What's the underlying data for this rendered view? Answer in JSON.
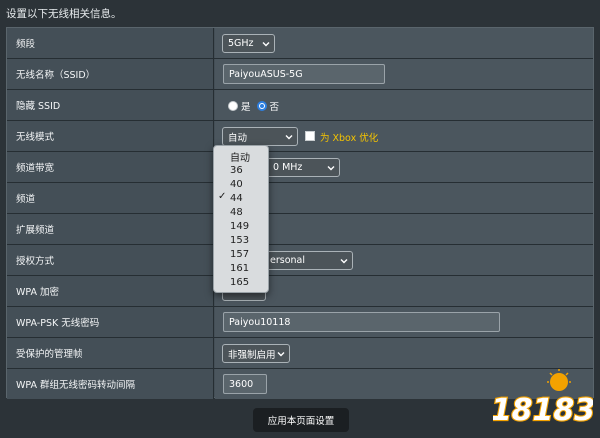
{
  "intro": "设置以下无线相关信息。",
  "rows": [
    {
      "label": "频段",
      "value": "5GHz"
    },
    {
      "label": "无线名称（SSID）",
      "value": "PaiyouASUS-5G"
    },
    {
      "label": "隐藏 SSID",
      "options": [
        "是",
        "否"
      ],
      "selected": "否"
    },
    {
      "label": "无线模式",
      "value": "自动",
      "xbox_option": "为 Xbox 优化"
    },
    {
      "label": "频道带宽",
      "value_visible": "0 MHz"
    },
    {
      "label": "频道"
    },
    {
      "label": "扩展频道"
    },
    {
      "label": "授权方式",
      "value_visible": "ersonal"
    },
    {
      "label": "WPA 加密"
    },
    {
      "label": "WPA-PSK 无线密码",
      "value": "Paiyou10118"
    },
    {
      "label": "受保护的管理帧",
      "value": "非强制启用"
    },
    {
      "label": "WPA 群组无线密码转动间隔",
      "value": "3600"
    }
  ],
  "channel_dropdown": {
    "options": [
      "自动",
      "36",
      "40",
      "44",
      "48",
      "149",
      "153",
      "157",
      "161",
      "165"
    ],
    "selected": "44"
  },
  "apply_button": "应用本页面设置",
  "watermark": "18183",
  "colors": {
    "accent": "#2d7fe0",
    "xbox_text": "#f5c400",
    "page_bg": "#2c3338"
  }
}
